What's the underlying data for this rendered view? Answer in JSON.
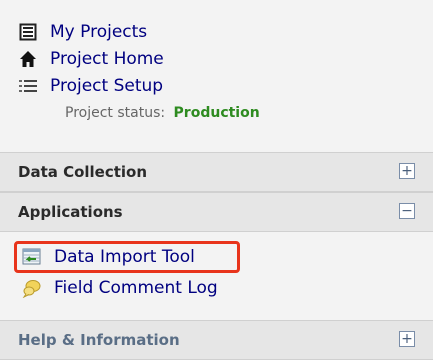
{
  "nav": {
    "my_projects": "My Projects",
    "project_home": "Project Home",
    "project_setup": "Project Setup"
  },
  "status": {
    "label": "Project status:",
    "value": "Production"
  },
  "sections": {
    "data_collection": "Data Collection",
    "applications": "Applications",
    "help": "Help & Information"
  },
  "toggles": {
    "expand": "+",
    "collapse": "−"
  },
  "apps": {
    "data_import_tool": "Data Import Tool",
    "field_comment_log": "Field Comment Log"
  },
  "colors": {
    "link": "#000080",
    "production": "#2e8b20",
    "highlight": "#e8341b"
  },
  "icons": {
    "my_projects": "list-document-icon",
    "project_home": "home-icon",
    "project_setup": "list-icon",
    "data_import": "import-table-icon",
    "field_comment": "comment-log-icon"
  }
}
